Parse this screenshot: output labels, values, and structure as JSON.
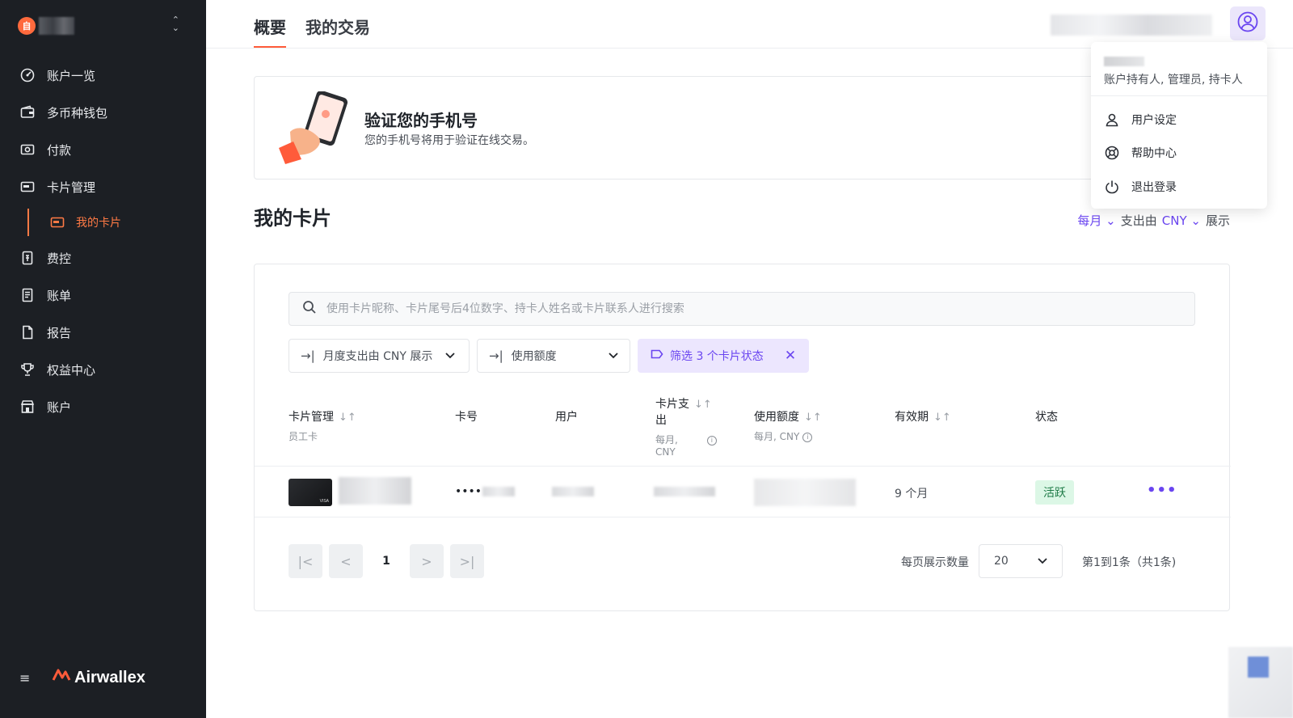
{
  "sidebar": {
    "org_logo_glyph": "自",
    "nav": [
      {
        "label": "账户一览",
        "icon": "dashboard-icon"
      },
      {
        "label": "多币种钱包",
        "icon": "wallet-icon"
      },
      {
        "label": "付款",
        "icon": "payment-icon"
      },
      {
        "label": "卡片管理",
        "icon": "card-icon"
      }
    ],
    "sub_item": {
      "label": "我的卡片",
      "icon": "card-icon"
    },
    "nav2": [
      {
        "label": "费控",
        "icon": "expense-icon"
      },
      {
        "label": "账单",
        "icon": "bill-icon"
      },
      {
        "label": "报告",
        "icon": "report-icon"
      },
      {
        "label": "权益中心",
        "icon": "trophy-icon"
      },
      {
        "label": "账户",
        "icon": "store-icon"
      }
    ],
    "brand": "Airwallex"
  },
  "tabs": [
    {
      "label": "概要",
      "active": true
    },
    {
      "label": "我的交易",
      "active": false
    }
  ],
  "verify_banner": {
    "title": "验证您的手机号",
    "description": "您的手机号将用于验证在线交易。"
  },
  "section_title": "我的卡片",
  "spend_control": {
    "period": "每月",
    "spend_label": "支出由",
    "currency": "CNY",
    "suffix": "展示"
  },
  "search": {
    "placeholder": "使用卡片昵称、卡片尾号后4位数字、持卡人姓名或卡片联系人进行搜索"
  },
  "filters": {
    "spend_filter": "月度支出由 CNY 展示",
    "limit_filter": "使用额度",
    "status_tag": "筛选 3 个卡片状态"
  },
  "table": {
    "headers": {
      "card": "卡片管理",
      "card_sub": "员工卡",
      "number": "卡号",
      "user": "用户",
      "spend_line1": "卡片支",
      "spend_line2": "出",
      "spend_sub1": "每月,",
      "spend_sub2": "CNY",
      "limit": "使用额度",
      "limit_sub": "每月, CNY",
      "expiry": "有效期",
      "status": "状态"
    },
    "rows": [
      {
        "card_brand": "VISA",
        "number_mask": "••••",
        "expiry": "9 个月",
        "status": "活跃"
      }
    ]
  },
  "pagination": {
    "current_page": "1",
    "per_page_label": "每页展示数量",
    "per_page_value": "20",
    "range_text": "第1到1条（共1条)"
  },
  "user_menu": {
    "roles": "账户持有人, 管理员, 持卡人",
    "items": [
      {
        "label": "用户设定",
        "icon": "user-icon"
      },
      {
        "label": "帮助中心",
        "icon": "help-icon"
      },
      {
        "label": "退出登录",
        "icon": "power-icon"
      }
    ]
  },
  "colors": {
    "accent_orange": "#ff5b3a",
    "accent_purple": "#6a45f0",
    "sidebar_bg": "#1c1f24",
    "status_green_bg": "#dcf7e6"
  }
}
